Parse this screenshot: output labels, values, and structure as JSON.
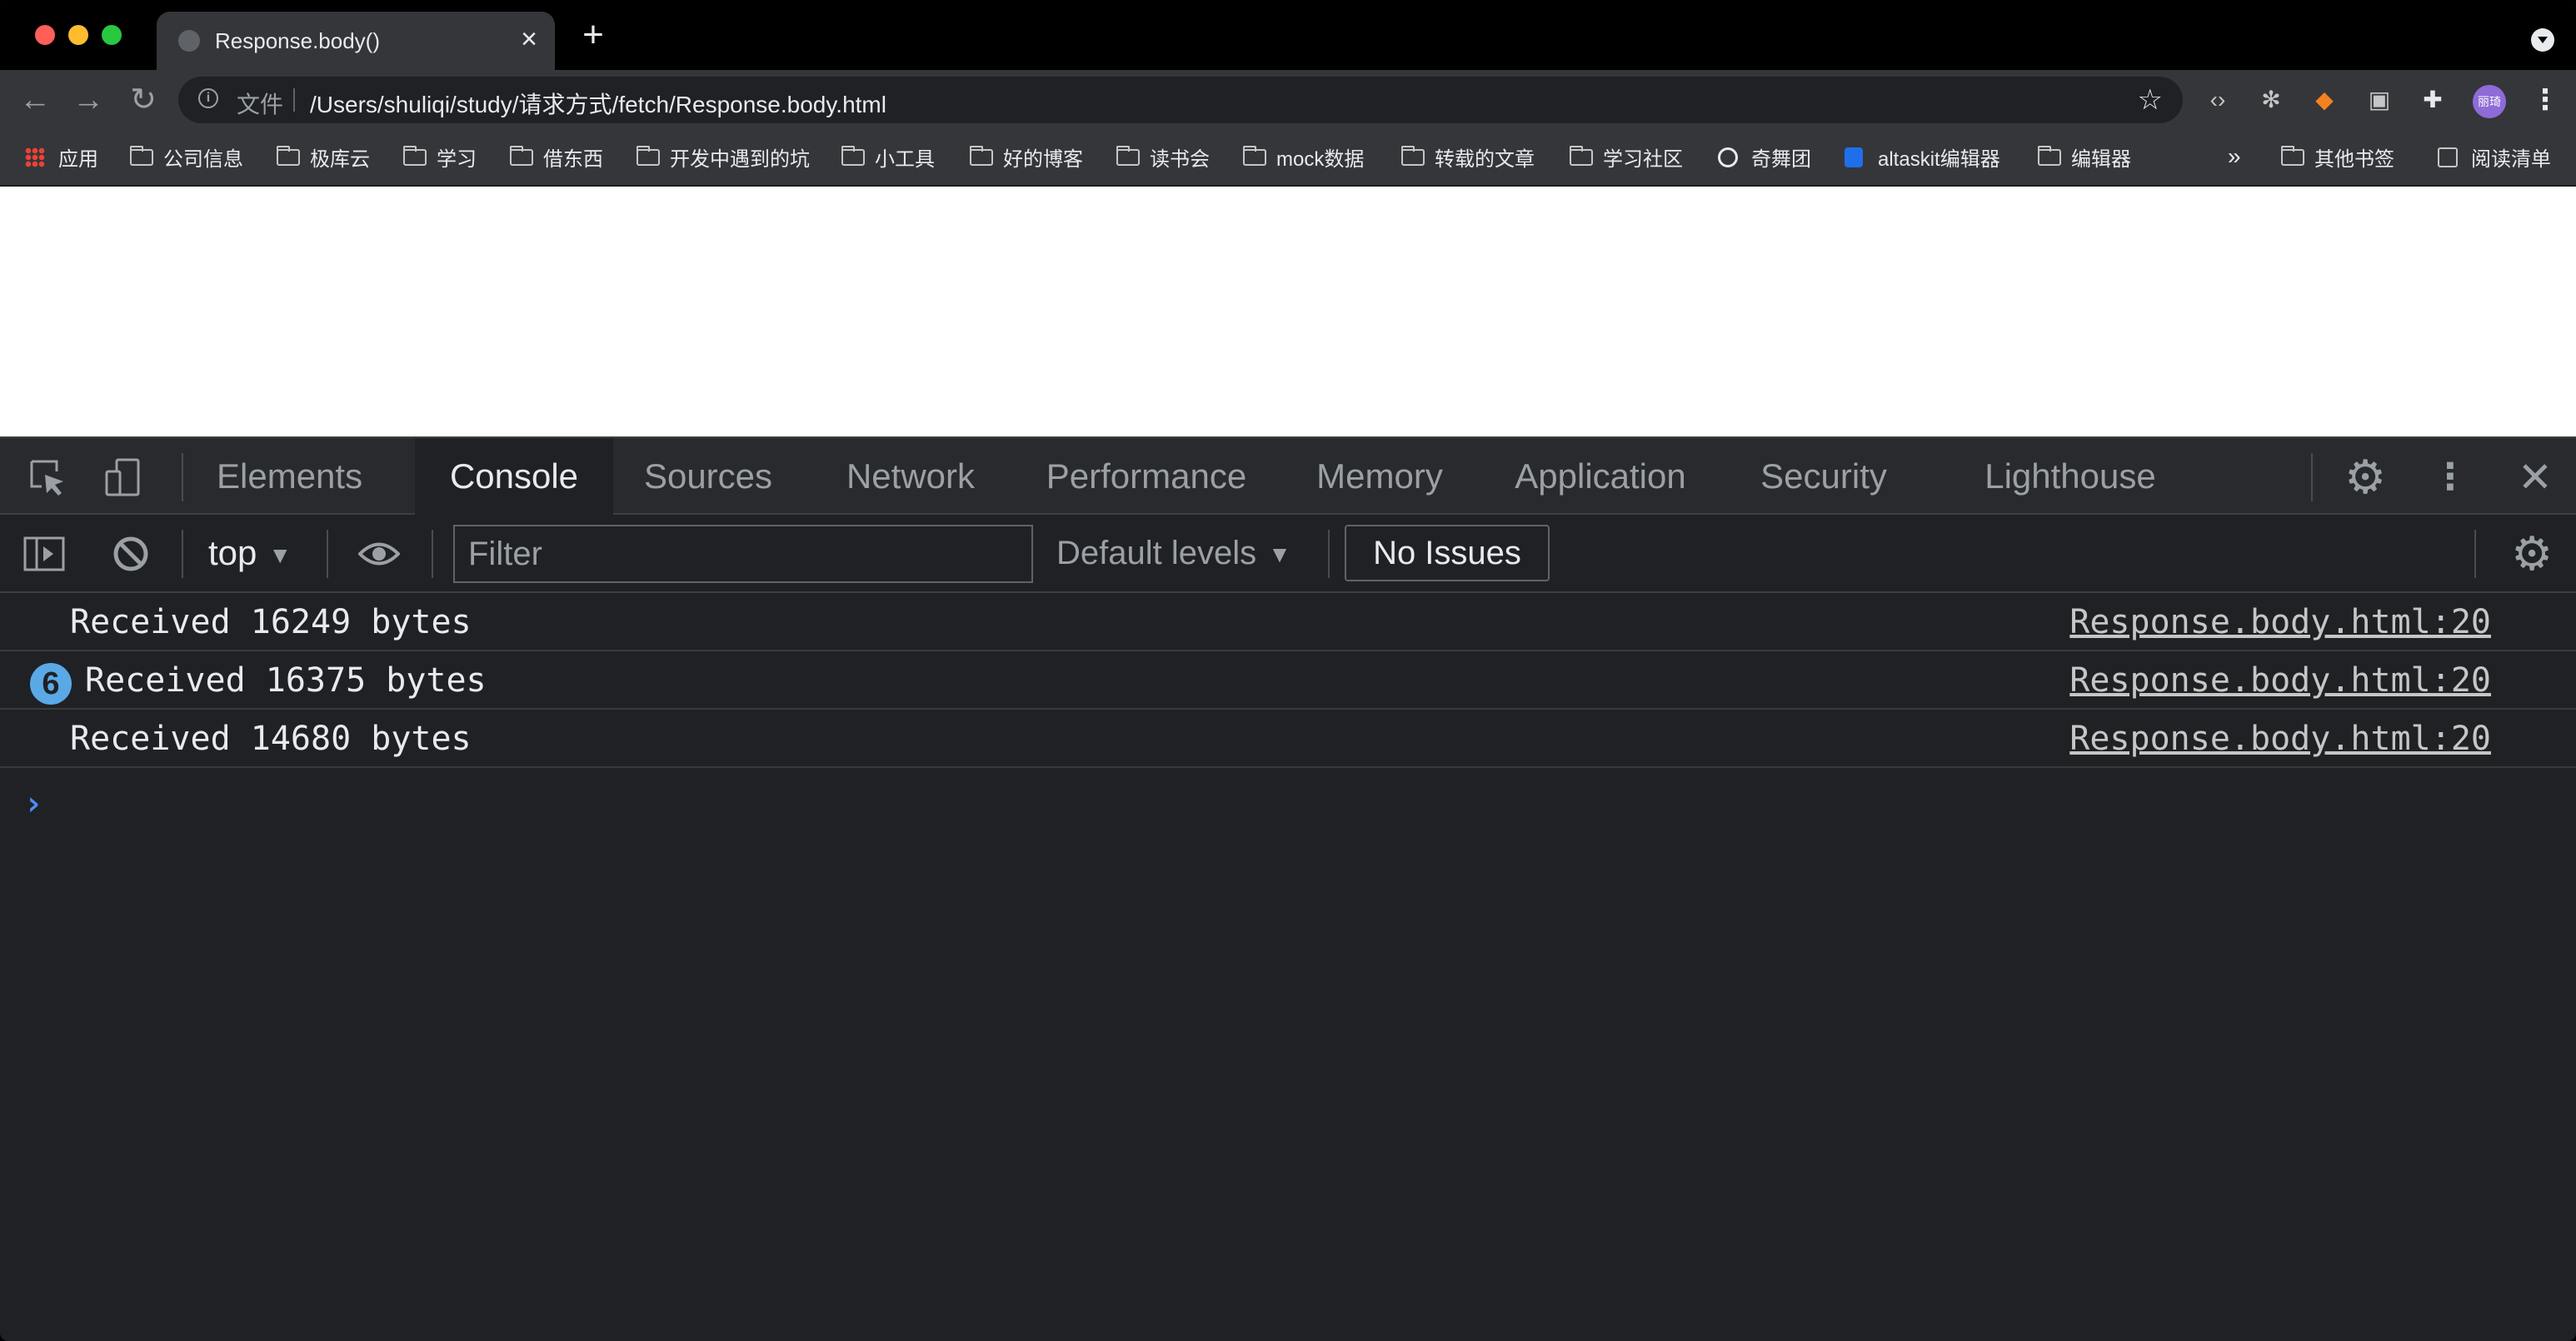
{
  "browser": {
    "tab": {
      "title": "Response.body()",
      "favicon": "globe-icon"
    },
    "new_tab_symbol": "+",
    "address": {
      "scheme_label": "文件",
      "url": "/Users/shuliqi/study/请求方式/fetch/Response.body.html"
    },
    "avatar_text": "丽琦",
    "bookmarks": [
      {
        "label": "应用",
        "icon": "apps-icon"
      },
      {
        "label": "公司信息",
        "icon": "folder-icon"
      },
      {
        "label": "极库云",
        "icon": "folder-icon"
      },
      {
        "label": "学习",
        "icon": "folder-icon"
      },
      {
        "label": "借东西",
        "icon": "folder-icon"
      },
      {
        "label": "开发中遇到的坑",
        "icon": "folder-icon"
      },
      {
        "label": "小工具",
        "icon": "folder-icon"
      },
      {
        "label": "好的博客",
        "icon": "folder-icon"
      },
      {
        "label": "读书会",
        "icon": "folder-icon"
      },
      {
        "label": "mock数据",
        "icon": "folder-icon"
      },
      {
        "label": "转载的文章",
        "icon": "folder-icon"
      },
      {
        "label": "学习社区",
        "icon": "folder-icon"
      },
      {
        "label": "奇舞团",
        "icon": "globe-icon"
      },
      {
        "label": "altaskit编辑器",
        "icon": "blue-badge-icon"
      },
      {
        "label": "编辑器",
        "icon": "folder-icon"
      }
    ],
    "bookmarks_overflow": "»",
    "other_bookmarks": "其他书签",
    "reading_list": "阅读清单"
  },
  "devtools": {
    "tabs": [
      "Elements",
      "Console",
      "Sources",
      "Network",
      "Performance",
      "Memory",
      "Application",
      "Security",
      "Lighthouse"
    ],
    "active_tab": "Console",
    "console": {
      "context": "top",
      "filter_placeholder": "Filter",
      "levels": "Default levels",
      "issues": "No Issues",
      "messages": [
        {
          "text": "Received 16249 bytes",
          "source": "Response.body.html:20",
          "count": null
        },
        {
          "text": "Received 16375 bytes",
          "source": "Response.body.html:20",
          "count": "6"
        },
        {
          "text": "Received 14680 bytes",
          "source": "Response.body.html:20",
          "count": null
        }
      ],
      "prompt": "›"
    }
  },
  "colors": {
    "window_bg": "#202124",
    "tab_bg": "#35363a",
    "accent_blue": "#4c8df6",
    "badge_blue": "#5aa9e6"
  }
}
